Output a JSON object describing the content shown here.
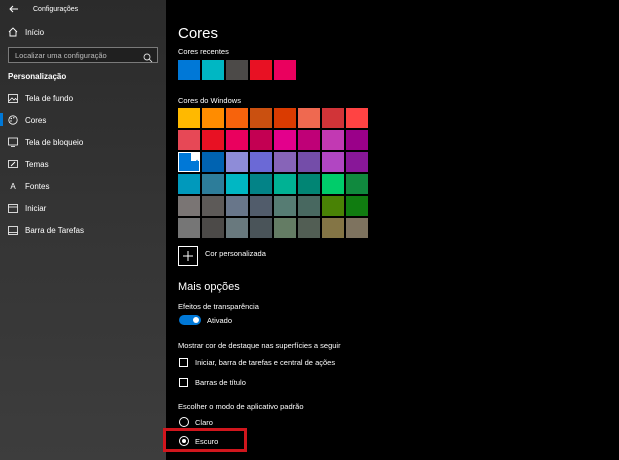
{
  "app": {
    "title": "Configurações"
  },
  "sidebar": {
    "home_label": "Início",
    "search_placeholder": "Localizar uma configuração",
    "section": "Personalização",
    "items": [
      {
        "label": "Tela de fundo",
        "icon": "picture-icon"
      },
      {
        "label": "Cores",
        "icon": "palette-icon",
        "active": true
      },
      {
        "label": "Tela de bloqueio",
        "icon": "lock-screen-icon"
      },
      {
        "label": "Temas",
        "icon": "brush-icon"
      },
      {
        "label": "Fontes",
        "icon": "font-icon"
      },
      {
        "label": "Iniciar",
        "icon": "start-icon"
      },
      {
        "label": "Barra de Tarefas",
        "icon": "taskbar-icon"
      }
    ]
  },
  "main": {
    "title": "Cores",
    "recent_label": "Cores recentes",
    "recent_colors": [
      "#0078d7",
      "#00b7c3",
      "#4c4a48",
      "#e81123",
      "#ea005e"
    ],
    "windows_label": "Cores do Windows",
    "windows_colors": [
      "#ffb900",
      "#ff8c00",
      "#f7630c",
      "#ca5010",
      "#da3b01",
      "#ef6950",
      "#d13438",
      "#ff4343",
      "#e74856",
      "#e81123",
      "#ea005e",
      "#c30052",
      "#e3008c",
      "#bf0077",
      "#c239b3",
      "#9a0089",
      "#0078d7",
      "#0063b1",
      "#8e8cd8",
      "#6b69d6",
      "#8764b8",
      "#744da9",
      "#b146c2",
      "#881798",
      "#0099bc",
      "#2d7d9a",
      "#00b7c3",
      "#038387",
      "#00b294",
      "#018574",
      "#00cc6a",
      "#10893e",
      "#7a7574",
      "#5d5a58",
      "#68768a",
      "#515c6b",
      "#567c73",
      "#486860",
      "#498205",
      "#107c10",
      "#767676",
      "#4c4a48",
      "#69797e",
      "#4a5459",
      "#647c64",
      "#525e54",
      "#847545",
      "#7e735f"
    ],
    "selected_color": "#0078d7",
    "custom_color_label": "Cor personalizada",
    "more_options_title": "Mais opções",
    "transparency_label": "Efeitos de transparência",
    "transparency_state": "Ativado",
    "accent_surfaces_label": "Mostrar cor de destaque nas superfícies a seguir",
    "checkbox_start": "Iniciar, barra de tarefas e central de ações",
    "checkbox_title": "Barras de título",
    "app_mode_label": "Escolher o modo de aplicativo padrão",
    "mode_light": "Claro",
    "mode_dark": "Escuro",
    "mode_selected": "Escuro"
  }
}
